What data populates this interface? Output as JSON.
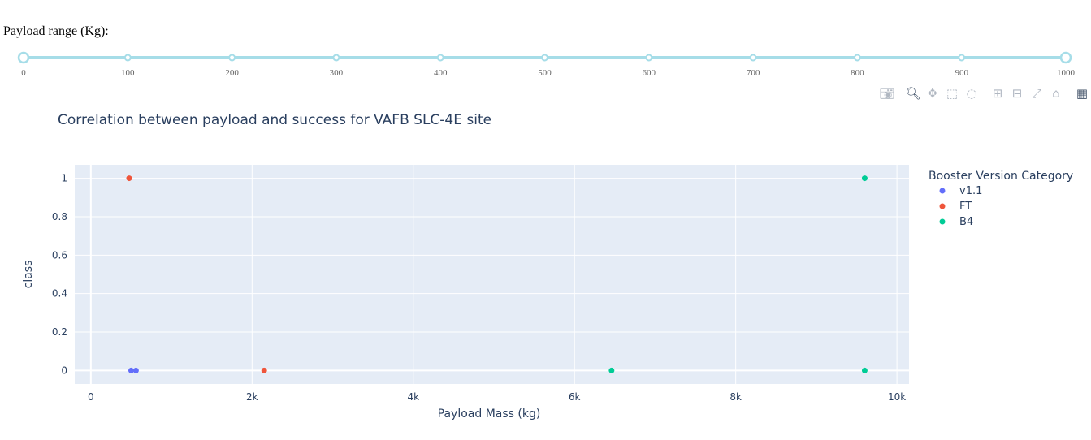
{
  "slider": {
    "label": "Payload range (Kg):",
    "min": 0,
    "max": 1000,
    "value": [
      0,
      1000
    ],
    "marks": [
      "0",
      "100",
      "200",
      "300",
      "400",
      "500",
      "600",
      "700",
      "800",
      "900",
      "1000"
    ],
    "track_color": "#a6dde8",
    "handle_color": "#a6dde8"
  },
  "toolbar": {
    "buttons": [
      {
        "name": "camera-icon",
        "glyph": "📷︎"
      },
      {
        "name": "zoom-icon",
        "glyph": "🔍︎"
      },
      {
        "name": "pan-icon",
        "glyph": "✥"
      },
      {
        "name": "box-select-icon",
        "glyph": "⬚"
      },
      {
        "name": "lasso-select-icon",
        "glyph": "◌"
      },
      {
        "name": "zoom-in-icon",
        "glyph": "⊞"
      },
      {
        "name": "zoom-out-icon",
        "glyph": "⊟"
      },
      {
        "name": "autoscale-icon",
        "glyph": "⤢"
      },
      {
        "name": "reset-axes-icon",
        "glyph": "⌂"
      },
      {
        "name": "plotly-logo-icon",
        "glyph": "▦"
      }
    ]
  },
  "chart_data": {
    "type": "scatter",
    "title": "Correlation between payload and success for VAFB SLC-4E site",
    "xlabel": "Payload Mass (kg)",
    "ylabel": "class",
    "xlim": [
      -200,
      10150
    ],
    "ylim": [
      -0.07,
      1.07
    ],
    "xticks": [
      0,
      2000,
      4000,
      6000,
      8000,
      10000
    ],
    "xtick_labels": [
      "0",
      "2k",
      "4k",
      "6k",
      "8k",
      "10k"
    ],
    "yticks": [
      0,
      0.2,
      0.4,
      0.6,
      0.8,
      1
    ],
    "ytick_labels": [
      "0",
      "0.2",
      "0.4",
      "0.6",
      "0.8",
      "1"
    ],
    "grid": true,
    "plot_bgcolor": "#e5ecf6",
    "legend": {
      "title": "Booster Version Category",
      "placement": "right"
    },
    "series": [
      {
        "name": "v1.1",
        "color": "#636efa",
        "points": [
          [
            500,
            0
          ],
          [
            560,
            0
          ]
        ]
      },
      {
        "name": "FT",
        "color": "#ef553b",
        "points": [
          [
            475,
            1
          ],
          [
            2150,
            0
          ]
        ]
      },
      {
        "name": "B4",
        "color": "#00cc96",
        "points": [
          [
            9600,
            1
          ],
          [
            6460,
            0
          ],
          [
            9600,
            0
          ]
        ]
      }
    ]
  }
}
